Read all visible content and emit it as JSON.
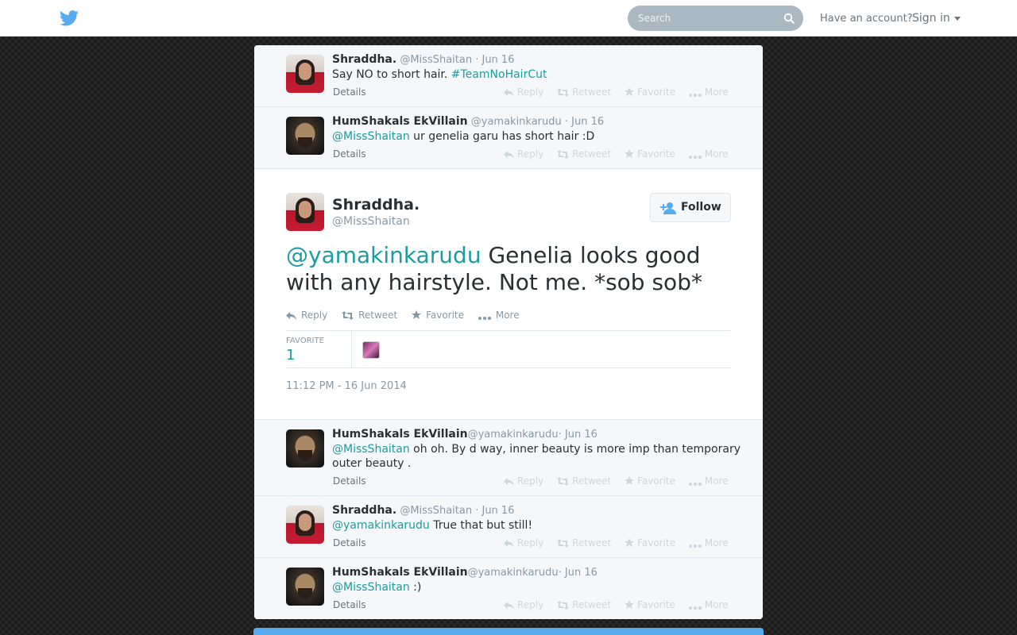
{
  "header": {
    "search_placeholder": "Search",
    "have_account": "Have an account?",
    "sign_in": "Sign in"
  },
  "actions": {
    "reply": "Reply",
    "retweet": "Retweet",
    "favorite": "Favorite",
    "more": "More",
    "details": "Details"
  },
  "tweets_before": [
    {
      "name": "Shraddha.",
      "handle": "@MissShaitan",
      "date": "· Jun 16",
      "text": "Say NO to short hair. ",
      "hashtag": "#TeamNoHairCut"
    },
    {
      "name": "HumShakals EkVillain",
      "handle": "@yamakinkarudu",
      "date": "· Jun 16",
      "mention": "@MissShaitan",
      "text": " ur genelia garu has short hair :D"
    }
  ],
  "focus": {
    "name": "Shraddha.",
    "handle": "@MissShaitan",
    "follow": "Follow",
    "mention": "@yamakinkarudu",
    "text": " Genelia looks good with any hairstyle. Not me. *sob sob*",
    "favorite_label": "FAVORITE",
    "favorite_count": "1",
    "timestamp": "11:12 PM - 16 Jun 2014"
  },
  "tweets_after": [
    {
      "name": "HumShakals EkVillain",
      "handle": "@yamakinkarudu",
      "date": "· Jun 16",
      "mention": "@MissShaitan",
      "text": " oh oh. By d way, inner beauty is more imp than temporary outer beauty ."
    },
    {
      "name": "Shraddha.",
      "handle": "@MissShaitan",
      "date": "· Jun 16",
      "mention": "@yamakinkarudu",
      "text": " True that but still!"
    },
    {
      "name": "HumShakals EkVillain",
      "handle": "@yamakinkarudu",
      "date": "· Jun 16",
      "mention": "@MissShaitan",
      "text": " :)"
    }
  ],
  "colors": {
    "brand_blue": "#55acee",
    "link_teal": "#1c9ba0",
    "muted_text": "#8899a6"
  }
}
